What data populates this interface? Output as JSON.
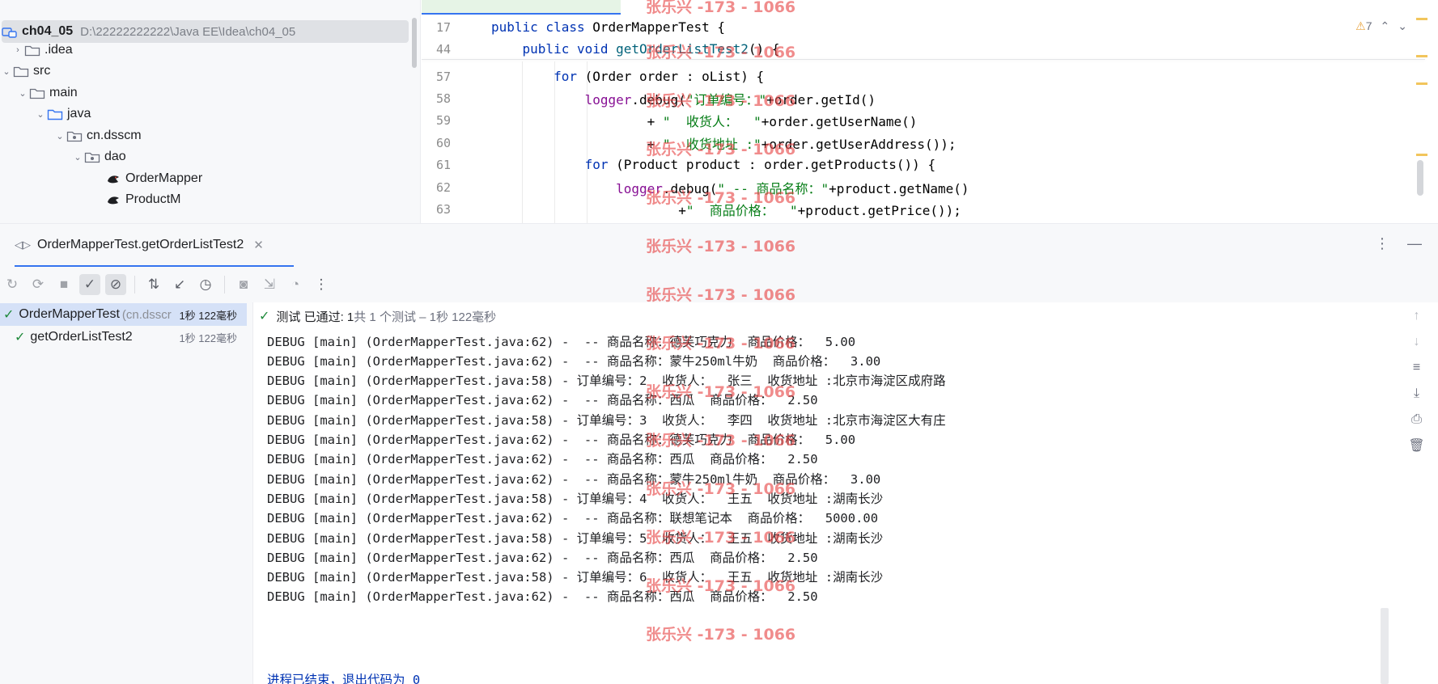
{
  "project_tree": {
    "root": {
      "name": "ch04_05",
      "path": "D:\\22222222222\\Java EE\\Idea\\ch04_05"
    },
    "items": [
      {
        "label": ".idea",
        "icon": "folder-icon"
      },
      {
        "label": "src",
        "icon": "folder-icon"
      },
      {
        "label": "main",
        "icon": "folder-icon"
      },
      {
        "label": "java",
        "icon": "source-folder-icon"
      },
      {
        "label": "cn.dsscm",
        "icon": "package-icon"
      },
      {
        "label": "dao",
        "icon": "package-icon"
      },
      {
        "label": "OrderMapper",
        "icon": "mybatis-mapper-icon"
      },
      {
        "label": "ProductM",
        "icon": "mybatis-mapper-icon"
      }
    ]
  },
  "editor": {
    "warning_count": "7",
    "sticky_lines": [
      {
        "num": "17",
        "tokens": [
          [
            "kw",
            "public class "
          ],
          [
            "cls",
            "OrderMapperTest {"
          ]
        ]
      },
      {
        "num": "44",
        "tokens": [
          [
            "kw",
            "    public void "
          ],
          [
            "fn",
            "getOrderListTest2"
          ],
          [
            "cls",
            "() {"
          ]
        ]
      }
    ],
    "lines": [
      {
        "num": "57",
        "tokens": [
          [
            "kw",
            "        for "
          ],
          [
            "cls",
            "(Order order : "
          ],
          [
            "cls",
            "oList) {"
          ]
        ]
      },
      {
        "num": "58",
        "tokens": [
          [
            "fld",
            "            logger"
          ],
          [
            "cls",
            ".debug("
          ],
          [
            "str",
            "\"订单编号：\""
          ],
          [
            "cls",
            "+order.getId()"
          ]
        ]
      },
      {
        "num": "59",
        "tokens": [
          [
            "cls",
            "                    + "
          ],
          [
            "str",
            "\"  收货人：  \""
          ],
          [
            "cls",
            "+order.getUserName()"
          ]
        ]
      },
      {
        "num": "60",
        "tokens": [
          [
            "cls",
            "                    + "
          ],
          [
            "str",
            "\"  收货地址 :\""
          ],
          [
            "cls",
            "+order.getUserAddress());"
          ]
        ]
      },
      {
        "num": "61",
        "tokens": [
          [
            "kw",
            "            for "
          ],
          [
            "cls",
            "(Product product : order.getProducts()) {"
          ]
        ]
      },
      {
        "num": "62",
        "tokens": [
          [
            "fld",
            "                logger"
          ],
          [
            "cls",
            ".debug("
          ],
          [
            "str",
            "\" -- 商品名称：\""
          ],
          [
            "cls",
            "+product.getName()"
          ]
        ]
      },
      {
        "num": "63",
        "tokens": [
          [
            "cls",
            "                        +"
          ],
          [
            "str",
            "\"  商品价格：  \""
          ],
          [
            "cls",
            "+product.getPrice());"
          ]
        ]
      }
    ]
  },
  "run_window": {
    "tab_label": "OrderMapperTest.getOrderListTest2",
    "status_prefix": "测试 已通过: 1",
    "status_detail": "共 1 个测试 – 1秒 122毫秒",
    "test_tree": [
      {
        "label": "OrderMapperTest",
        "pkg": "(cn.dsscr",
        "time": "1秒 122毫秒"
      },
      {
        "label": "getOrderListTest2",
        "time": "1秒 122毫秒"
      }
    ],
    "log_lines": [
      "DEBUG [main] (OrderMapperTest.java:62) -  -- 商品名称：德芙巧克力  商品价格：  5.00",
      "DEBUG [main] (OrderMapperTest.java:62) -  -- 商品名称：蒙牛250ml牛奶  商品价格：  3.00",
      "DEBUG [main] (OrderMapperTest.java:58) - 订单编号：2  收货人：  张三  收货地址 :北京市海淀区成府路",
      "DEBUG [main] (OrderMapperTest.java:62) -  -- 商品名称：西瓜  商品价格：  2.50",
      "DEBUG [main] (OrderMapperTest.java:58) - 订单编号：3  收货人：  李四  收货地址 :北京市海淀区大有庄",
      "DEBUG [main] (OrderMapperTest.java:62) -  -- 商品名称：德芙巧克力  商品价格：  5.00",
      "DEBUG [main] (OrderMapperTest.java:62) -  -- 商品名称：西瓜  商品价格：  2.50",
      "DEBUG [main] (OrderMapperTest.java:62) -  -- 商品名称：蒙牛250ml牛奶  商品价格：  3.00",
      "DEBUG [main] (OrderMapperTest.java:58) - 订单编号：4  收货人：  王五  收货地址 :湖南长沙",
      "DEBUG [main] (OrderMapperTest.java:62) -  -- 商品名称：联想笔记本  商品价格：  5000.00",
      "DEBUG [main] (OrderMapperTest.java:58) - 订单编号：5  收货人：  王五  收货地址 :湖南长沙",
      "DEBUG [main] (OrderMapperTest.java:62) -  -- 商品名称：西瓜  商品价格：  2.50",
      "DEBUG [main] (OrderMapperTest.java:58) - 订单编号：6  收货人：  王五  收货地址 :湖南长沙",
      "DEBUG [main] (OrderMapperTest.java:62) -  -- 商品名称：西瓜  商品价格：  2.50"
    ],
    "exit_message": "进程已结束，退出代码为 0"
  },
  "watermark": "张乐兴 -173 - 1066",
  "colors": {
    "accent": "#3574f0",
    "pass": "#208a3c",
    "keyword": "#0033b3",
    "string": "#067d17",
    "field": "#871094",
    "watermark": "#e64646"
  }
}
